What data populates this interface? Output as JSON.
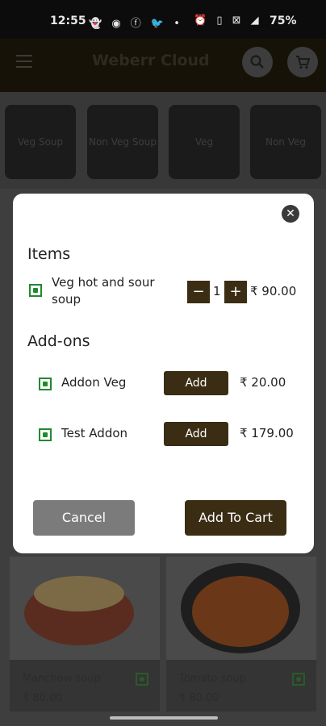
{
  "status_bar": {
    "time": "12:55",
    "battery": "75%",
    "left_icons": "👻 ◉ ⓕ 🐦 •",
    "right_icons": "⏰ ▯ ⊠ ◢"
  },
  "app_bar": {
    "title": "Weberr Cloud"
  },
  "categories": [
    {
      "label": "Veg Soup"
    },
    {
      "label": "Non Veg Soup"
    },
    {
      "label": "Veg"
    },
    {
      "label": "Non Veg"
    }
  ],
  "products": [
    {
      "name": "Manchow soup",
      "price": "₹ 80.00"
    },
    {
      "name": "Tomato soup",
      "price": "₹ 80.00"
    }
  ],
  "dialog": {
    "close_glyph": "✕",
    "items_title": "Items",
    "item": {
      "name": "Veg hot and sour soup",
      "quantity": "1",
      "price": "₹ 90.00",
      "minus": "−",
      "plus": "+"
    },
    "addons_title": "Add-ons",
    "addons": [
      {
        "name": "Addon Veg",
        "button": "Add",
        "price": "₹ 20.00"
      },
      {
        "name": "Test Addon",
        "button": "Add",
        "price": "₹ 179.00"
      }
    ],
    "cancel_label": "Cancel",
    "add_to_cart_label": "Add To Cart"
  },
  "colors": {
    "primary": "#3b2d14",
    "veg_green": "#1f8a2e",
    "cancel_gray": "#7b7b7b"
  }
}
